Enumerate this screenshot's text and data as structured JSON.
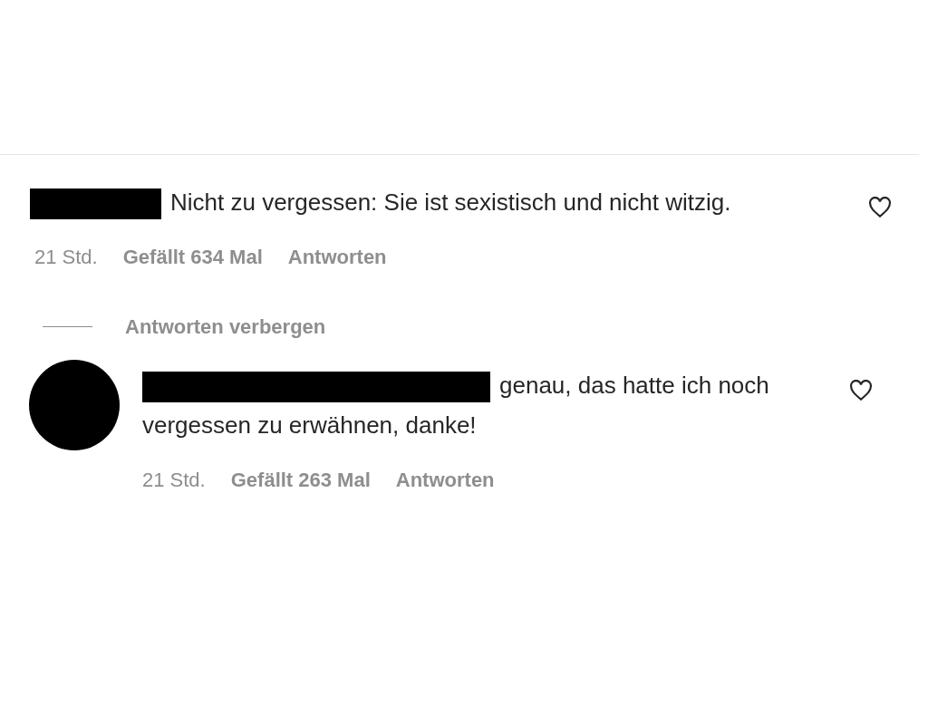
{
  "comments": [
    {
      "text": "Nicht zu vergessen: Sie ist sexistisch und nicht witzig.",
      "liked": false,
      "time": "21 Std.",
      "likes": "Gefällt 634 Mal",
      "reply": "Antworten",
      "avatar": false,
      "replies_toggle": "Antworten verbergen"
    },
    {
      "text": "genau, das hatte ich noch vergessen zu erwähnen, danke!",
      "liked": false,
      "time": "21 Std.",
      "likes": "Gefällt 263 Mal",
      "reply": "Antworten",
      "avatar": true
    }
  ]
}
